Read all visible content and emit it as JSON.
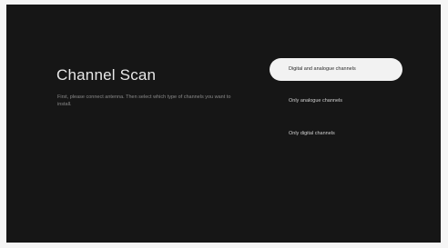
{
  "screen": {
    "title": "Channel Scan",
    "description": "First, please connect antenna. Then select which type of channels you want to install."
  },
  "options": [
    {
      "label": "Digital and analogue channels",
      "focused": true
    },
    {
      "label": "Only analogue channels",
      "focused": false
    },
    {
      "label": "Only digital channels",
      "focused": false
    }
  ],
  "colors": {
    "background": "#161616",
    "focus_pill": "#f2f2f2",
    "title_text": "#e8e8e8",
    "muted_text": "#8a8a8a"
  }
}
